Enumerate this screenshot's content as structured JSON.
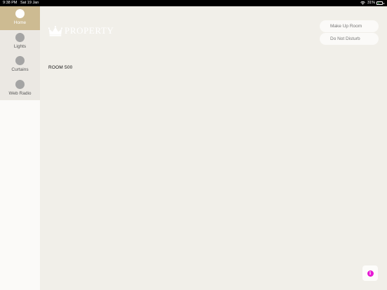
{
  "status_bar": {
    "time": "9:38 PM",
    "date": "Sat 19 Jan",
    "battery_percent": "31%",
    "battery_level": 0.31,
    "icons": [
      "wifi-icon",
      "battery-icon"
    ]
  },
  "sidebar": {
    "items": [
      {
        "label": "Home",
        "active": true
      },
      {
        "label": "Lights",
        "active": false
      },
      {
        "label": "Curtains",
        "active": false
      },
      {
        "label": "Web Radio",
        "active": false
      }
    ]
  },
  "header": {
    "logo_text": "PROPERTY",
    "logo_icon": "crown-icon"
  },
  "main": {
    "room": "ROOM 500"
  },
  "actions": {
    "make_up_room": "Make Up Room",
    "do_not_disturb": "Do Not Disturb"
  },
  "info_button": {
    "glyph": "i",
    "color": "#e619d4"
  },
  "colors": {
    "background": "#f1efe9",
    "sidebar_active": "#cdbb92",
    "nav_dot": "#a4a4a4",
    "battery_fill": "#4cd964"
  }
}
